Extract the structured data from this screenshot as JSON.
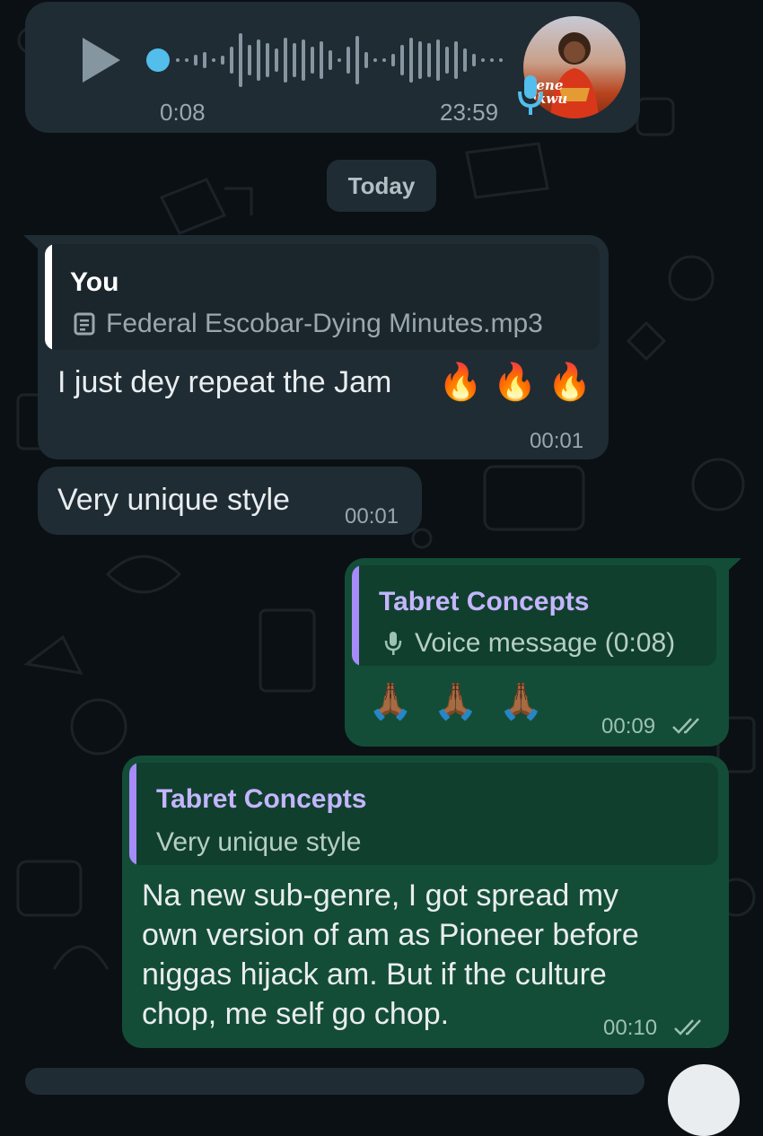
{
  "voice_note": {
    "elapsed": "0:08",
    "sent_time": "23:59",
    "avatar_text": "kene ukwu"
  },
  "date_chip": "Today",
  "messages": [
    {
      "quote_author": "You",
      "quote_text": "Federal Escobar-Dying Minutes.mp3",
      "text": "I just dey repeat the Jam",
      "emoji": "🔥 🔥 🔥",
      "time": "00:01"
    },
    {
      "text": "Very unique style",
      "time": "00:01"
    },
    {
      "quote_author": "Tabret Concepts",
      "quote_text": "Voice message (0:08)",
      "emoji": "🙏🏾 🙏🏾 🙏🏾",
      "time": "00:09"
    },
    {
      "quote_author": "Tabret Concepts",
      "quote_text": "Very unique style",
      "text_lines": [
        "Na new sub-genre, I got spread my",
        "own version of am as Pioneer before",
        "niggas hijack am. But if the culture",
        "chop, me self go chop."
      ],
      "time": "00:10"
    }
  ],
  "colors": {
    "incoming_bubble": "#1f2c34",
    "outgoing_bubble": "#144d37",
    "quote_you": "#ffffff",
    "quote_tabret": "#a78bfa",
    "play_dot": "#53bdeb",
    "read_ticks": "#9dc2b0"
  }
}
